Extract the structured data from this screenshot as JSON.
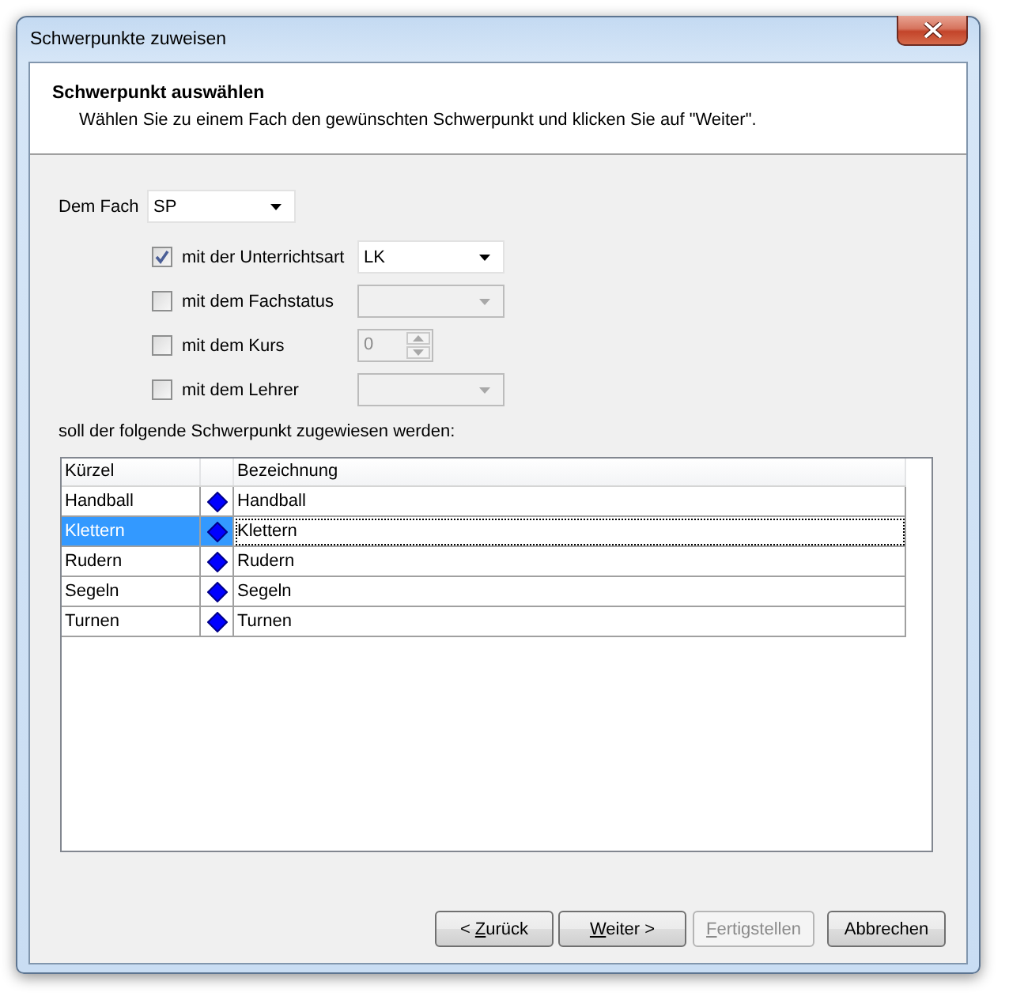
{
  "window": {
    "title": "Schwerpunkte zuweisen"
  },
  "header": {
    "title": "Schwerpunkt auswählen",
    "subtitle": "Wählen Sie zu einem Fach den gewünschten Schwerpunkt und klicken Sie auf \"Weiter\"."
  },
  "subject": {
    "label": "Dem Fach",
    "value": "SP"
  },
  "filters": [
    {
      "kind": "combo",
      "label": "mit der Unterrichtsart",
      "checked": true,
      "disabled": false,
      "value": "LK"
    },
    {
      "kind": "combo",
      "label": "mit dem Fachstatus",
      "checked": false,
      "disabled": true
    },
    {
      "kind": "spinner",
      "label": "mit dem Kurs",
      "checked": false,
      "disabled": true,
      "value": "0"
    },
    {
      "kind": "combo",
      "label": "mit dem Lehrer",
      "checked": false,
      "disabled": true
    }
  ],
  "table_caption": "soll der folgende Schwerpunkt zugewiesen werden:",
  "table": {
    "columns": {
      "kuerzel": "Kürzel",
      "bezeichnung": "Bezeichnung"
    },
    "rows": [
      {
        "kuerzel": "Handball",
        "bezeichnung": "Handball",
        "selected": false
      },
      {
        "kuerzel": "Klettern",
        "bezeichnung": "Klettern",
        "selected": true
      },
      {
        "kuerzel": "Rudern",
        "bezeichnung": "Rudern",
        "selected": false
      },
      {
        "kuerzel": "Segeln",
        "bezeichnung": "Segeln",
        "selected": false
      },
      {
        "kuerzel": "Turnen",
        "bezeichnung": "Turnen",
        "selected": false
      }
    ]
  },
  "buttons": [
    {
      "label_start": "< ",
      "access_key": "Z",
      "label_end": "urück",
      "disabled": false
    },
    {
      "access_key": "W",
      "label_end": "eiter >",
      "disabled": false
    },
    {
      "access_key": "F",
      "label_end": "ertigstellen",
      "disabled": true
    },
    {
      "label_start": "Abbrechen",
      "disabled": false
    }
  ]
}
